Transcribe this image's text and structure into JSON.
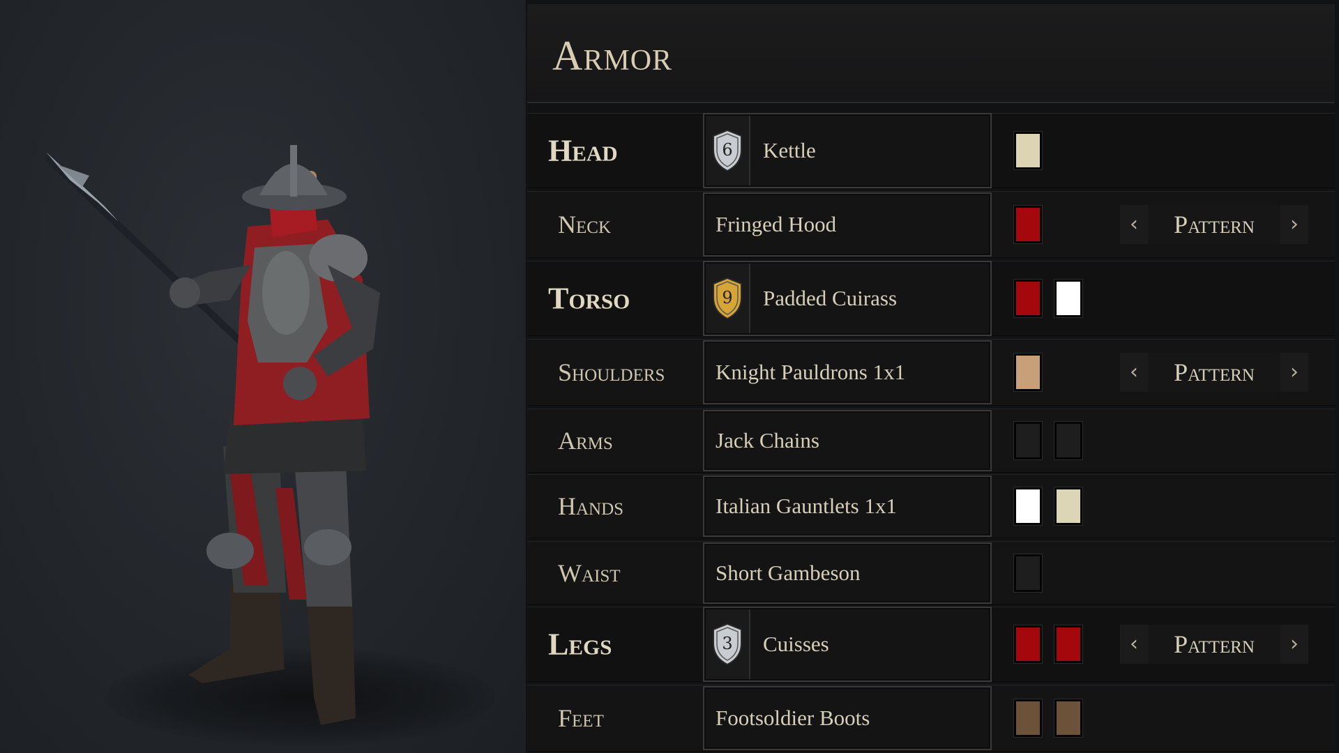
{
  "panel": {
    "title": "Armor"
  },
  "slots": [
    {
      "label": "Head",
      "main": true,
      "item": "Kettle",
      "tier": "6",
      "tier_color": "#c9cdd1",
      "colors": [
        "#ddd4b3"
      ],
      "pattern": null
    },
    {
      "label": "Neck",
      "main": false,
      "item": "Fringed Hood",
      "tier": null,
      "colors": [
        "#a4070c"
      ],
      "pattern": "Pattern"
    },
    {
      "label": "Torso",
      "main": true,
      "item": "Padded Cuirass",
      "tier": "9",
      "tier_color": "#d6a437",
      "colors": [
        "#a4070c",
        "#ffffff"
      ],
      "pattern": null
    },
    {
      "label": "Shoulders",
      "main": false,
      "item": "Knight Pauldrons 1x1",
      "tier": null,
      "colors": [
        "#c79f79"
      ],
      "pattern": "Pattern"
    },
    {
      "label": "Arms",
      "main": false,
      "item": "Jack Chains",
      "tier": null,
      "colors": [
        "#1e1e1f",
        "#1e1e1f"
      ],
      "pattern": null
    },
    {
      "label": "Hands",
      "main": false,
      "item": "Italian Gauntlets 1x1",
      "tier": null,
      "colors": [
        "#ffffff",
        "#ddd6b6"
      ],
      "pattern": null
    },
    {
      "label": "Waist",
      "main": false,
      "item": "Short Gambeson",
      "tier": null,
      "colors": [
        "#1e1e1f"
      ],
      "pattern": null
    },
    {
      "label": "Legs",
      "main": true,
      "item": "Cuisses",
      "tier": "3",
      "tier_color": "#c9cdd1",
      "colors": [
        "#a4070c",
        "#a4070c"
      ],
      "pattern": "Pattern"
    },
    {
      "label": "Feet",
      "main": false,
      "item": "Footsoldier Boots",
      "tier": null,
      "colors": [
        "#6b5239",
        "#6b5239"
      ],
      "pattern": null
    }
  ],
  "icons": {
    "tier_badge": "shield-icon",
    "prev": "chevron-left-icon",
    "next": "chevron-right-icon"
  }
}
